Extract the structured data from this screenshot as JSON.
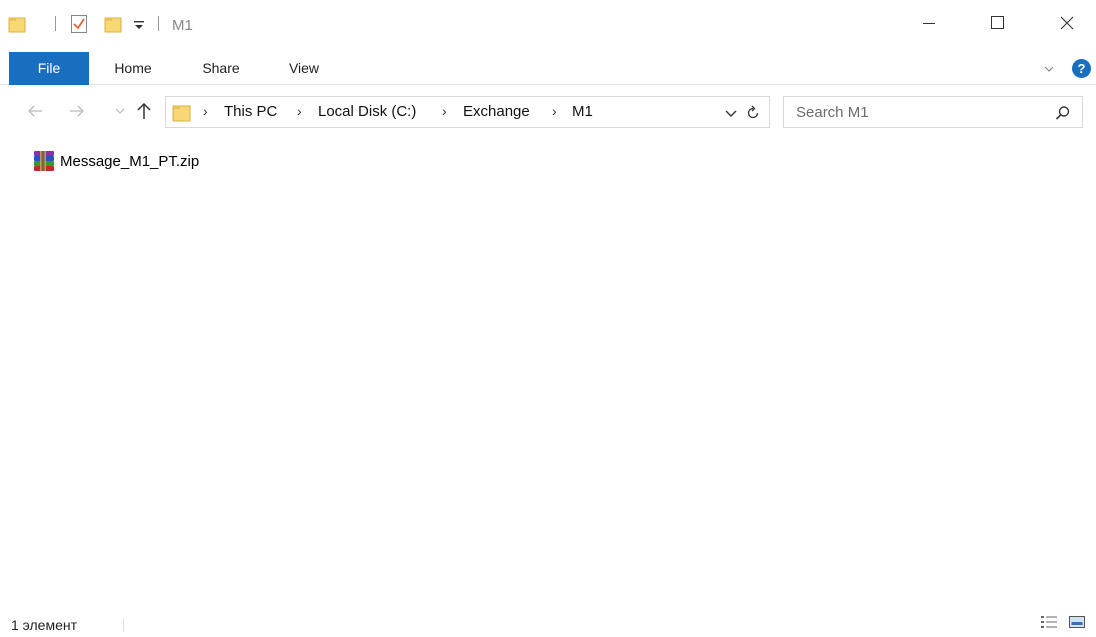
{
  "titlebar": {
    "title": "M1",
    "qat": [
      "folder-icon",
      "properties-check-icon",
      "new-folder-icon",
      "customize-qat-dropdown-icon"
    ],
    "window_buttons": [
      "minimize",
      "maximize",
      "close"
    ]
  },
  "ribbon": {
    "tabs": [
      {
        "label": "File",
        "active": true
      },
      {
        "label": "Home"
      },
      {
        "label": "Share"
      },
      {
        "label": "View"
      }
    ],
    "help": "?",
    "accent_color": "#1a6ec0"
  },
  "navigation": {
    "breadcrumbs": [
      "This PC",
      "Local Disk (C:)",
      "Exchange",
      "M1"
    ],
    "search_placeholder": "Search M1"
  },
  "content": {
    "items": [
      {
        "name": "Message_M1_PT.zip",
        "icon": "winrar-archive-icon"
      }
    ]
  },
  "statusbar": {
    "item_count": "1 элемент",
    "views": [
      "details-view",
      "large-icons-view"
    ]
  }
}
